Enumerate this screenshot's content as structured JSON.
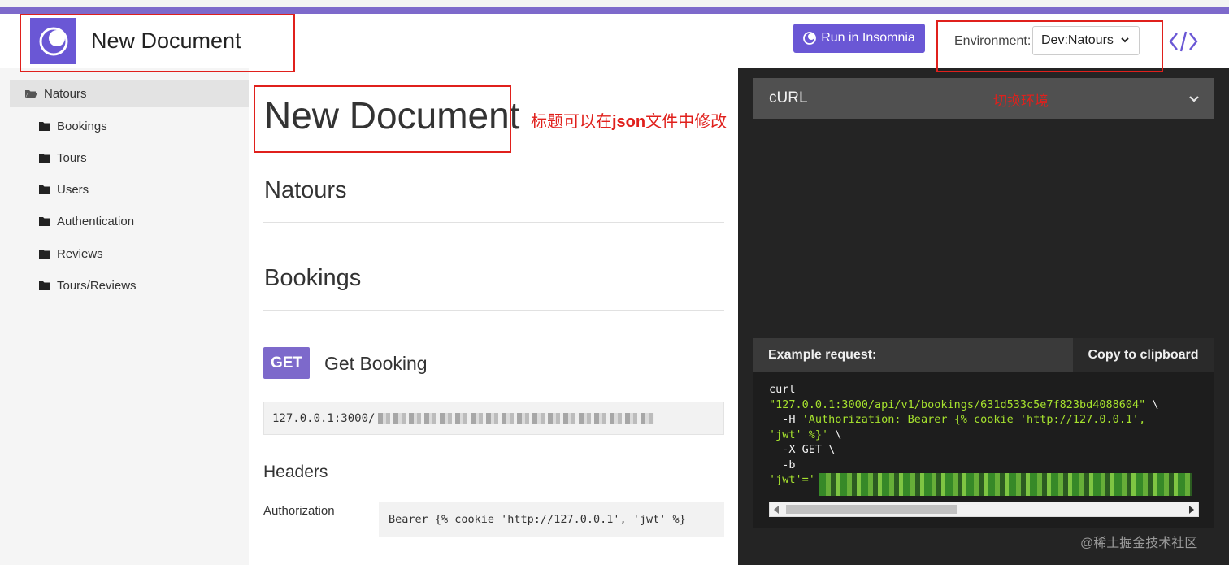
{
  "header": {
    "title": "New Document",
    "run_label": "Run in Insomnia",
    "environment_label": "Environment:",
    "environment_value": "Dev:Natours"
  },
  "sidebar": {
    "items": [
      {
        "label": "Natours",
        "active": true
      },
      {
        "label": "Bookings"
      },
      {
        "label": "Tours"
      },
      {
        "label": "Users"
      },
      {
        "label": "Authentication"
      },
      {
        "label": "Reviews"
      },
      {
        "label": "Tours/Reviews"
      }
    ]
  },
  "main": {
    "doc_title": "New Document",
    "annotation_prefix": "标题可以在",
    "annotation_bold": "json",
    "annotation_suffix": "文件中修改",
    "section_1": "Natours",
    "section_2": "Bookings",
    "method": "GET",
    "endpoint_name": "Get Booking",
    "url_visible": "127.0.0.1:3000/",
    "headers_title": "Headers",
    "auth_label": "Authorization",
    "auth_value": "Bearer {% cookie 'http://127.0.0.1', 'jwt' %}"
  },
  "right": {
    "curl_label": "cURL",
    "switch_annotation": "切换环境",
    "example_label": "Example request:",
    "copy_label": "Copy to clipboard",
    "code": {
      "l1": "curl",
      "l2": "\"127.0.0.1:3000/api/v1/bookings/631d533c5e7f823bd4088604\"",
      "l2_tail": " \\",
      "l3_a": "  -H ",
      "l3_b": "'Authorization: Bearer {% cookie 'http://127.0.0.1',",
      "l4_a": "'jwt' %}'",
      "l4_b": " \\",
      "l5": "  -X GET \\",
      "l6": "  -b",
      "l7": "'jwt'='"
    }
  },
  "watermark": "@稀土掘金技术社区",
  "colors": {
    "accent": "#7d69cb",
    "annotation_red": "#e0201c",
    "code_green": "#a6e22e"
  }
}
